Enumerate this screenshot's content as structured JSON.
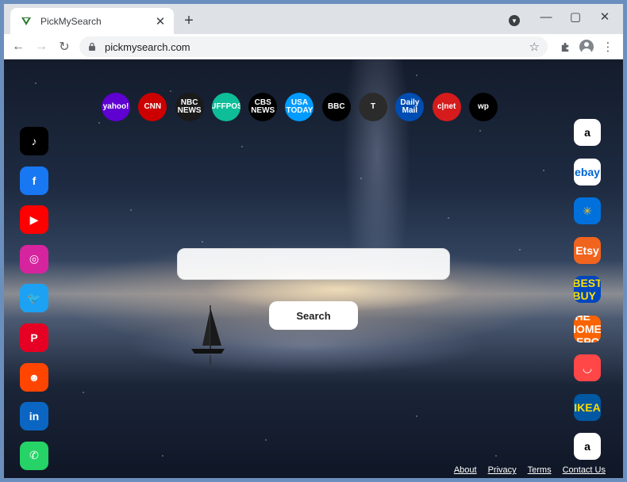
{
  "browser": {
    "tab_title": "PickMySearch",
    "new_tab_label": "+",
    "url": "pickmysearch.com",
    "window_controls": {
      "minimize": "—",
      "maximize": "▢",
      "close": "✕"
    }
  },
  "top_shortcuts": [
    {
      "name": "yahoo",
      "label": "yahoo!",
      "color": "#5f01d1"
    },
    {
      "name": "cnn",
      "label": "CNN",
      "color": "#cc0000"
    },
    {
      "name": "nbc-news",
      "label": "NBC NEWS",
      "color": "#1a1a1a"
    },
    {
      "name": "huffpost",
      "label": "HUFFPOST",
      "color": "#0dbe98"
    },
    {
      "name": "cbs-news",
      "label": "CBS NEWS",
      "color": "#000000"
    },
    {
      "name": "usa-today",
      "label": "USA TODAY",
      "color": "#009bff"
    },
    {
      "name": "bbc",
      "label": "BBC",
      "color": "#000000"
    },
    {
      "name": "nytimes",
      "label": "T",
      "color": "#2b2b2b"
    },
    {
      "name": "daily-mail",
      "label": "Daily Mail",
      "color": "#004db3"
    },
    {
      "name": "cnet",
      "label": "c|net",
      "color": "#d51b1b"
    },
    {
      "name": "washington-post",
      "label": "wp",
      "color": "#000000"
    }
  ],
  "left_shortcuts": [
    {
      "name": "tiktok",
      "label": "♪",
      "color": "#000000"
    },
    {
      "name": "facebook",
      "label": "f",
      "color": "#1877f2"
    },
    {
      "name": "youtube",
      "label": "▶",
      "color": "#ff0000"
    },
    {
      "name": "instagram",
      "label": "◎",
      "color": "#d6249f"
    },
    {
      "name": "twitter",
      "label": "🐦",
      "color": "#1da1f2"
    },
    {
      "name": "pinterest",
      "label": "P",
      "color": "#e60023"
    },
    {
      "name": "reddit",
      "label": "☻",
      "color": "#ff4500"
    },
    {
      "name": "linkedin",
      "label": "in",
      "color": "#0a66c2"
    },
    {
      "name": "whatsapp",
      "label": "✆",
      "color": "#25d366"
    }
  ],
  "right_shortcuts": [
    {
      "name": "amazon",
      "label": "a",
      "color": "#ffffff",
      "text_color": "#000000"
    },
    {
      "name": "ebay",
      "label": "ebay",
      "color": "#ffffff",
      "text_color": "#0064d2"
    },
    {
      "name": "walmart",
      "label": "✳",
      "color": "#0071dc",
      "text_color": "#ffc220"
    },
    {
      "name": "etsy",
      "label": "Etsy",
      "color": "#f1641e",
      "text_color": "#ffffff"
    },
    {
      "name": "best-buy",
      "label": "BEST BUY",
      "color": "#0046be",
      "text_color": "#ffe000"
    },
    {
      "name": "home-depot",
      "label": "THE HOME DEPOT",
      "color": "#f96302",
      "text_color": "#ffffff"
    },
    {
      "name": "aliexpress",
      "label": "◡",
      "color": "#ff4747",
      "text_color": "#ffffff"
    },
    {
      "name": "ikea",
      "label": "IKEA",
      "color": "#0058a3",
      "text_color": "#ffdb00"
    },
    {
      "name": "aol",
      "label": "a",
      "color": "#ffffff",
      "text_color": "#000000"
    }
  ],
  "search": {
    "placeholder": "",
    "button_label": "Search"
  },
  "footer": {
    "about": "About",
    "privacy": "Privacy",
    "terms": "Terms",
    "contact": "Contact Us"
  }
}
